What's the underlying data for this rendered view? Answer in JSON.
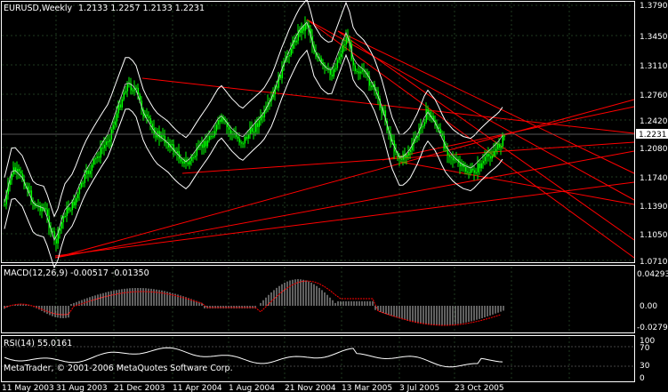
{
  "header": {
    "symbol": "EURUSD,Weekly",
    "ohlc": "1.2133 1.2257 1.2133 1.2231"
  },
  "price_axis": {
    "ticks": [
      "1.3790",
      "1.3450",
      "1.3110",
      "1.2760",
      "1.2420",
      "1.2231",
      "1.2080",
      "1.1740",
      "1.1390",
      "1.1050",
      "1.0710"
    ],
    "current": "1.2231"
  },
  "macd": {
    "label": "MACD(12,26,9) -0.00517 -0.01350",
    "ticks": [
      "0.04293",
      "0.00",
      "-0.02791"
    ]
  },
  "rsi": {
    "label": "RSI(14) 55.0161",
    "ticks": [
      "100",
      "70",
      "30",
      "0"
    ]
  },
  "copyright": "MetaTrader, © 2001-2006 MetaQuotes Software Corp.",
  "time_axis": {
    "labels": [
      "11 May 2003",
      "31 Aug 2003",
      "21 Dec 2003",
      "11 Apr 2004",
      "1 Aug 2004",
      "21 Nov 2004",
      "13 Mar 2005",
      "3 Jul 2005",
      "23 Oct 2005"
    ]
  },
  "colors": {
    "background": "#000000",
    "grid": "#1f3f1f",
    "candle": "#00ff00",
    "bands": "#ffffff",
    "trendlines": "#ff0000",
    "macd_hist": "#c0c0c0",
    "macd_signal": "#ff0000",
    "rsi_line": "#ffffff"
  },
  "chart_data": {
    "type": "line",
    "title": "EURUSD,Weekly",
    "series": [
      {
        "name": "EURUSD",
        "x": [
          "11 May 2003",
          "31 Aug 2003",
          "21 Dec 2003",
          "11 Apr 2004",
          "1 Aug 2004",
          "21 Nov 2004",
          "13 Mar 2005",
          "3 Jul 2005",
          "23 Oct 2005"
        ],
        "values": [
          1.17,
          1.08,
          1.26,
          1.2,
          1.23,
          1.32,
          1.3,
          1.2,
          1.18
        ]
      }
    ],
    "last_close": 1.2231,
    "ylim": [
      1.071,
      1.379
    ]
  }
}
